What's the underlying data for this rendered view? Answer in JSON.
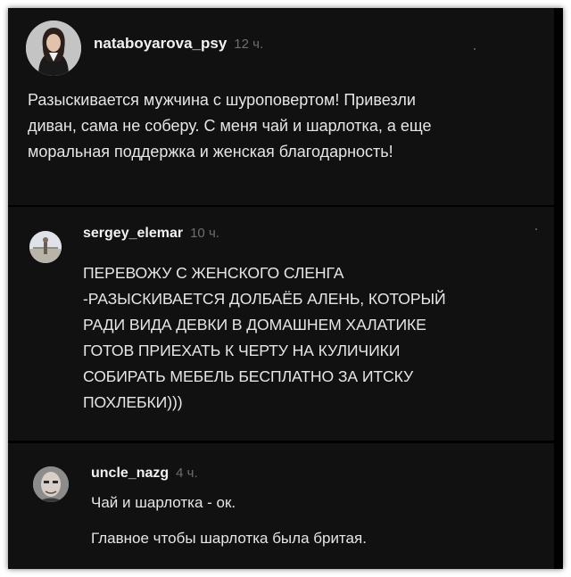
{
  "comments": [
    {
      "username": "nataboyarova_psy",
      "time": "12 ч.",
      "avatar": "woman-portrait-avatar",
      "lines": [
        "Разыскивается мужчина с шуроповертом! Привезли",
        "диван, сама не соберу. С меня чай и шарлотка, а еще",
        "моральная поддержка и женская благодарность!"
      ]
    },
    {
      "username": "sergey_elemar",
      "time": "10 ч.",
      "avatar": "outdoor-photo-avatar",
      "lines": [
        "ПЕРЕВОЖУ С ЖЕНСКОГО СЛЕНГА",
        "-РАЗЫСКИВАЕТСЯ ДОЛБАЁБ АЛЕНЬ, КОТОРЫЙ",
        "РАДИ ВИДА ДЕВКИ В ДОМАШНЕМ ХАЛАТИКЕ",
        "ГОТОВ ПРИЕХАТЬ К ЧЕРТУ НА КУЛИЧИКИ",
        "СОБИРАТЬ МЕБЕЛЬ БЕСПЛАТНО ЗА ИТСКУ",
        "ПОХЛЕБКИ)))"
      ]
    },
    {
      "username": "uncle_nazg",
      "time": "4 ч.",
      "avatar": "man-face-avatar",
      "lines": [
        "Чай и шарлотка - ок.",
        "Главное чтобы шарлотка была бритая."
      ]
    }
  ],
  "colors": {
    "background": "#111111",
    "username": "#f2f2f2",
    "time": "#6e6e6e",
    "text": "#e6e6e6"
  }
}
